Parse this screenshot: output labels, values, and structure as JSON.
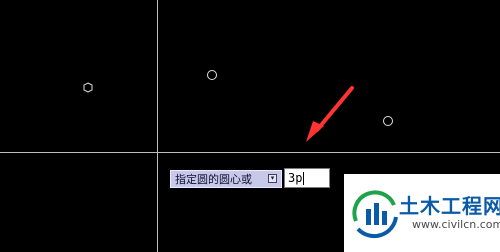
{
  "command_line": {
    "prompt_text": "指定圆的圆心或",
    "dropdown_glyph": "▾",
    "input_value": "3p"
  },
  "watermark": {
    "name": "土木工程网",
    "url": "www.civilcn.com"
  },
  "colors": {
    "canvas_bg": "#000000",
    "crosshair": "#bdbdbd",
    "arrow": "#ff3333",
    "prompt_bg": "#c8c8e8",
    "logo_blue": "#0b5aa8",
    "logo_green": "#1fa34a"
  },
  "icons": [
    "crosshair-icon",
    "arrow-annotation-icon",
    "dropdown-arrow-icon",
    "civilcn-logo-icon"
  ]
}
